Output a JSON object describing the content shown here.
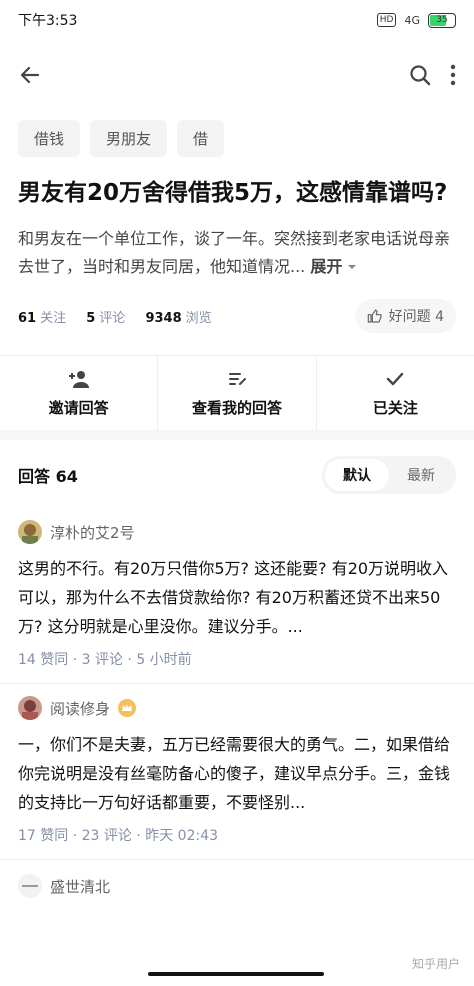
{
  "status": {
    "time": "下午3:53",
    "hd": "HD",
    "network": "4G",
    "battery": "35"
  },
  "tags": [
    "借钱",
    "男朋友",
    "借"
  ],
  "question": {
    "title": "男友有20万舍得借我5万，这感情靠谱吗?",
    "excerpt": "和男友在一个单位工作，谈了一年。突然接到老家电话说母亲去世了，当时和男友同居，他知道情况...",
    "expand_label": "展开",
    "follow_count": "61",
    "follow_label": "关注",
    "comment_count": "5",
    "comment_label": "评论",
    "view_count": "9348",
    "view_label": "浏览",
    "good_question": "好问题 4"
  },
  "actions": [
    {
      "label": "邀请回答",
      "icon": "add-user-icon"
    },
    {
      "label": "查看我的回答",
      "icon": "edit-list-icon"
    },
    {
      "label": "已关注",
      "icon": "check-icon"
    }
  ],
  "answers_header": {
    "label": "回答 64",
    "sort_default": "默认",
    "sort_latest": "最新"
  },
  "answers": [
    {
      "author": "淳朴的艾2号",
      "text": "这男的不行。有20万只借你5万? 这还能要? 有20万说明收入可以，那为什么不去借贷款给你? 有20万积蓄还贷不出来50万? 这分明就是心里没你。建议分手。...",
      "meta": "14 赞同 · 3 评论 · 5 小时前"
    },
    {
      "author": "阅读修身",
      "text": "一，你们不是夫妻，五万已经需要很大的勇气。二，如果借给你完说明是没有丝毫防备心的傻子，建议早点分手。三，金钱的支持比一万句好话都重要，不要怪别...",
      "meta": "17 赞同 · 23 评论 · 昨天 02:43"
    },
    {
      "author": "盛世清北"
    }
  ],
  "watermark": "知乎用户",
  "colors": {
    "meta_gray": "#8590a6",
    "tag_bg": "#f3f3f3",
    "accent_gold": "#f1c15a"
  }
}
